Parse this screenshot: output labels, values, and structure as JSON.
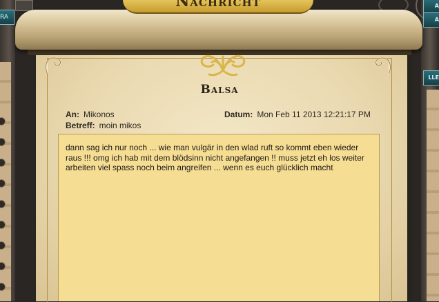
{
  "window": {
    "title": "Nachricht"
  },
  "side_left": {
    "button_label": "RA"
  },
  "side_right": {
    "button_label_top": "A",
    "button_label_mid": "A",
    "button_label_lower": "LLE"
  },
  "message": {
    "sender_title": "Balsa",
    "to_label": "An:",
    "to_value": "Mikonos",
    "subject_label": "Betreff:",
    "subject_value": "moin mikos",
    "date_label": "Datum:",
    "date_value": "Mon Feb 11 2013 12:21:17 PM",
    "body": "dann sag ich nur noch ... wie man vulgär in den wlad ruft so kommt eben wieder raus !!! omg ich hab mit dem blödsinn nicht angefangen !! muss jetzt eh los weiter arbeiten viel spass noch beim angreifen ... wenn es euch glücklich macht"
  }
}
